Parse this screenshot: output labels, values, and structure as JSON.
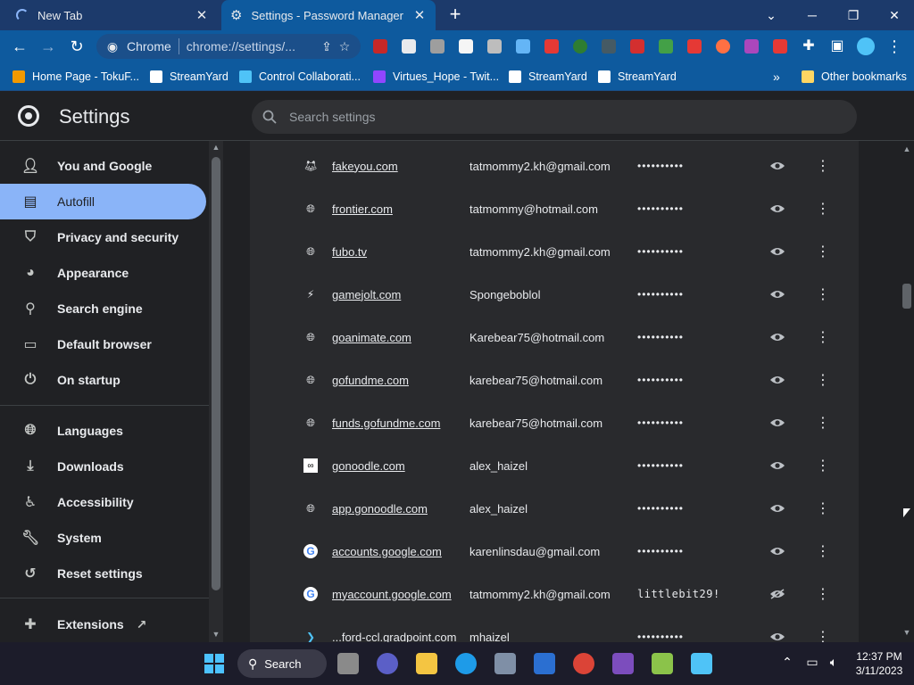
{
  "browser": {
    "tabs": [
      {
        "title": "New Tab",
        "active": false
      },
      {
        "title": "Settings - Password Manager",
        "active": true
      }
    ],
    "address_chip": "Chrome",
    "url": "chrome://settings/...",
    "bookmarks": [
      {
        "label": "Home Page - TokuF...",
        "color": "#f29900"
      },
      {
        "label": "StreamYard",
        "color": "#ffffff"
      },
      {
        "label": "Control Collaborati...",
        "color": "#4fc3f7"
      },
      {
        "label": "Virtues_Hope - Twit...",
        "color": "#9146ff"
      },
      {
        "label": "StreamYard",
        "color": "#ffffff"
      },
      {
        "label": "StreamYard",
        "color": "#ffffff"
      }
    ],
    "overflow": "»",
    "other_bookmarks": "Other bookmarks"
  },
  "settings": {
    "title": "Settings",
    "search_placeholder": "Search settings"
  },
  "sidebar": {
    "items": [
      {
        "label": "You and Google",
        "icon": "person-icon"
      },
      {
        "label": "Autofill",
        "icon": "clipboard-icon",
        "active": true
      },
      {
        "label": "Privacy and security",
        "icon": "shield-icon"
      },
      {
        "label": "Appearance",
        "icon": "palette-icon"
      },
      {
        "label": "Search engine",
        "icon": "search-icon"
      },
      {
        "label": "Default browser",
        "icon": "browser-icon"
      },
      {
        "label": "On startup",
        "icon": "power-icon"
      },
      {
        "label": "Languages",
        "icon": "globe-icon"
      },
      {
        "label": "Downloads",
        "icon": "download-icon"
      },
      {
        "label": "Accessibility",
        "icon": "accessibility-icon"
      },
      {
        "label": "System",
        "icon": "wrench-icon"
      },
      {
        "label": "Reset settings",
        "icon": "history-icon"
      },
      {
        "label": "Extensions",
        "icon": "puzzle-icon"
      }
    ]
  },
  "passwords": [
    {
      "site": "fakeyou.com",
      "user": "tatmommy2.kh@gmail.com",
      "password": "••••••••••",
      "favicon": "fox-icon"
    },
    {
      "site": "frontier.com",
      "user": "tatmommy@hotmail.com",
      "password": "••••••••••",
      "favicon": "globe-icon"
    },
    {
      "site": "fubo.tv",
      "user": "tatmommy2.kh@gmail.com",
      "password": "••••••••••",
      "favicon": "globe-icon"
    },
    {
      "site": "gamejolt.com",
      "user": "Spongeboblol",
      "password": "••••••••••",
      "favicon": "bolt-icon"
    },
    {
      "site": "goanimate.com",
      "user": "Karebear75@hotmail.com",
      "password": "••••••••••",
      "favicon": "globe-icon"
    },
    {
      "site": "gofundme.com",
      "user": "karebear75@hotmail.com",
      "password": "••••••••••",
      "favicon": "globe-icon"
    },
    {
      "site": "funds.gofundme.com",
      "user": "karebear75@hotmail.com",
      "password": "••••••••••",
      "favicon": "globe-icon"
    },
    {
      "site": "gonoodle.com",
      "user": "alex_haizel",
      "password": "••••••••••",
      "favicon": "gonoodle-icon"
    },
    {
      "site": "app.gonoodle.com",
      "user": "alex_haizel",
      "password": "••••••••••",
      "favicon": "globe-icon"
    },
    {
      "site": "accounts.google.com",
      "user": "karenlinsdau@gmail.com",
      "password": "••••••••••",
      "favicon": "google-icon"
    },
    {
      "site": "myaccount.google.com",
      "user": "tatmommy2.kh@gmail.com",
      "password": "littlebit29!",
      "favicon": "google-icon",
      "revealed": true
    },
    {
      "site": "...ford-ccl.gradpoint.com",
      "user": "mhaizel",
      "password": "••••••••••",
      "favicon": "gradpoint-icon"
    }
  ],
  "taskbar": {
    "search_label": "Search",
    "time": "12:37 PM",
    "date": "3/11/2023"
  },
  "colors": {
    "accent": "#8ab4f8",
    "tabstrip": "#1c3a6b",
    "toolbar": "#0e5a9e"
  }
}
